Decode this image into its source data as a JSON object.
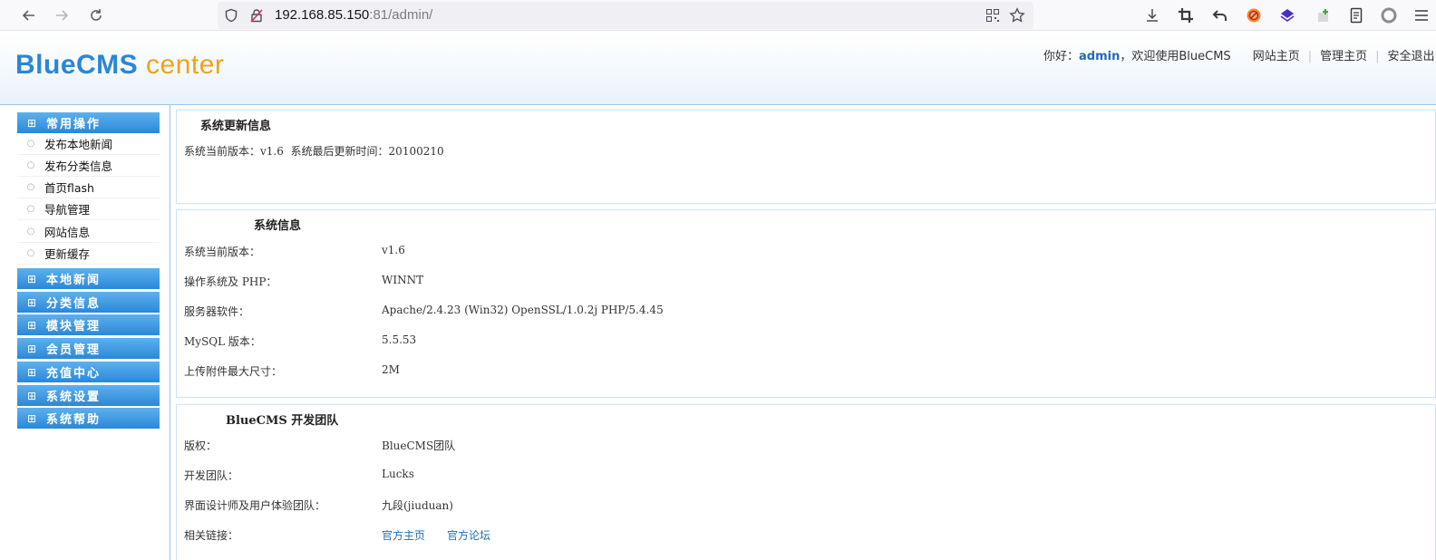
{
  "browser": {
    "url_host": "192.168.85.150",
    "url_port": ":81/admin/",
    "icons": [
      "back-icon",
      "forward-icon",
      "reload-icon",
      "shield-icon",
      "insecure-lock-icon",
      "qr-icon",
      "bookmark-star-icon",
      "download-icon",
      "crop-icon",
      "undo-icon",
      "blocker-icon",
      "extension-icon",
      "extension-green-icon",
      "reader-icon",
      "account-icon",
      "menu-icon"
    ]
  },
  "header": {
    "logo_main": "BlueCMS",
    "logo_sub": "center",
    "greeting_prefix": "你好：",
    "user": "admin",
    "greeting_suffix": "，欢迎使用BlueCMS",
    "link_site_home": "网站主页",
    "link_admin_home": "管理主页",
    "link_logout": "安全退出",
    "colors": {
      "brand_blue": "#2a86d6",
      "brand_orange": "#f2a218"
    }
  },
  "sidebar": {
    "groups": [
      {
        "label": "常用操作"
      },
      {
        "label": "本地新闻"
      },
      {
        "label": "分类信息"
      },
      {
        "label": "模块管理"
      },
      {
        "label": "会员管理"
      },
      {
        "label": "充值中心"
      },
      {
        "label": "系统设置"
      },
      {
        "label": "系统帮助"
      }
    ],
    "items": [
      {
        "label": "发布本地新闻"
      },
      {
        "label": "发布分类信息"
      },
      {
        "label": "首页flash"
      },
      {
        "label": "导航管理"
      },
      {
        "label": "网站信息"
      },
      {
        "label": "更新缓存"
      }
    ]
  },
  "update_panel": {
    "title": "系统更新信息",
    "version_label": "系统当前版本：",
    "version_value": "v1.6",
    "update_label": "系统最后更新时间：",
    "update_value": "20100210"
  },
  "sysinfo_panel": {
    "title": "系统信息",
    "rows": [
      {
        "label": "系统当前版本：",
        "value": "v1.6"
      },
      {
        "label": "操作系统及 PHP：",
        "value": "WINNT"
      },
      {
        "label": "服务器软件：",
        "value": "Apache/2.4.23 (Win32) OpenSSL/1.0.2j PHP/5.4.45"
      },
      {
        "label": "MySQL 版本：",
        "value": "5.5.53"
      },
      {
        "label": "上传附件最大尺寸：",
        "value": "2M"
      }
    ]
  },
  "team_panel": {
    "title": "BlueCMS 开发团队",
    "rows": [
      {
        "label": "版权：",
        "value": "BlueCMS团队"
      },
      {
        "label": "开发团队：",
        "value": "Lucks"
      },
      {
        "label": "界面设计师及用户体验团队：",
        "value": "九段(jiuduan)"
      }
    ],
    "links_label": "相关链接：",
    "link_official": "官方主页",
    "link_forum": "官方论坛"
  }
}
